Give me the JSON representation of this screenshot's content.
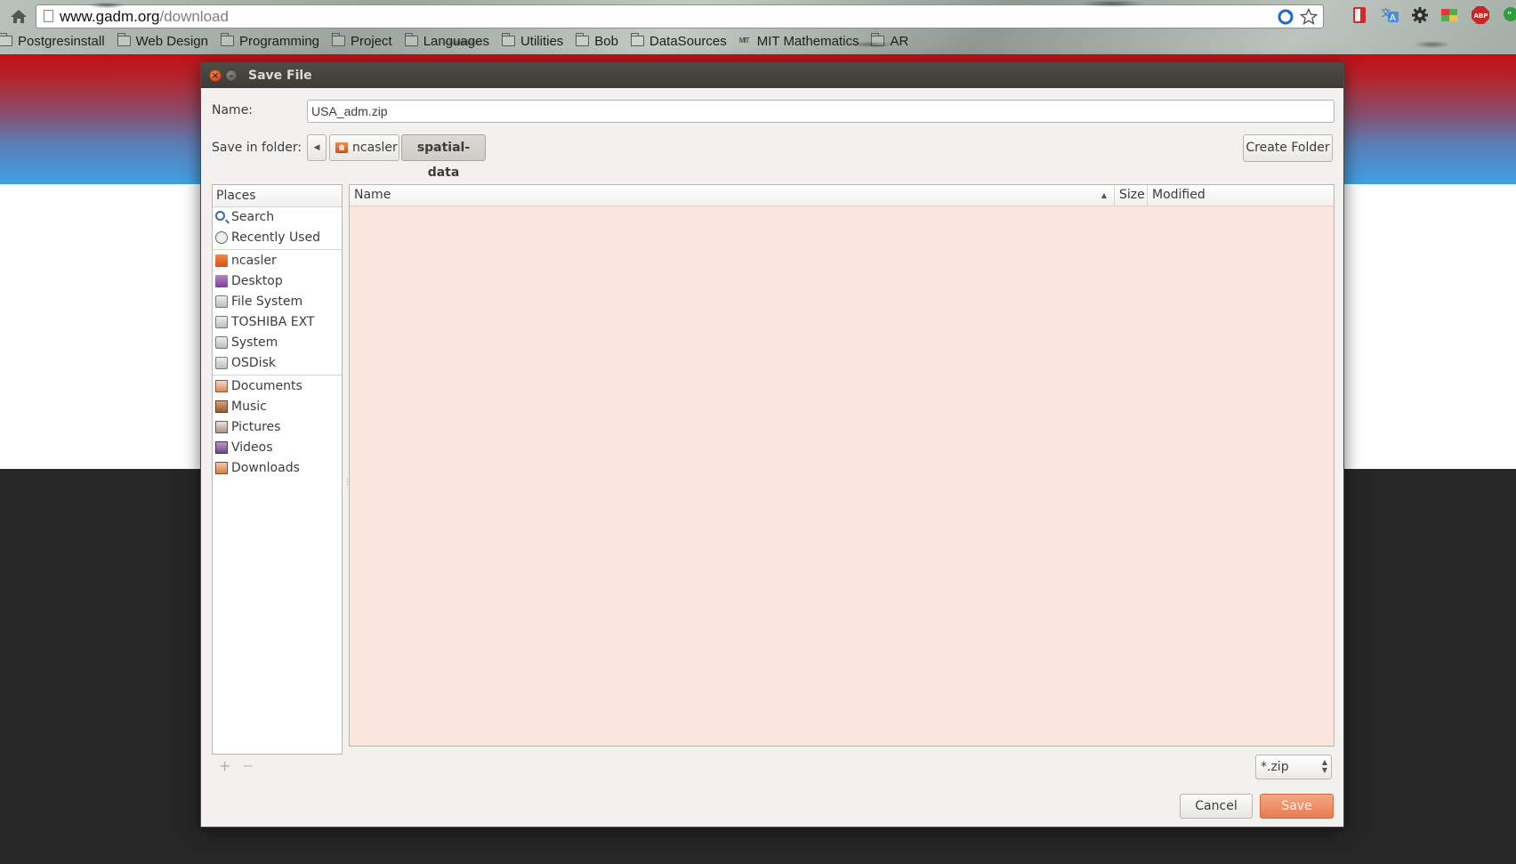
{
  "browser": {
    "url_domain": "www.gadm.org",
    "url_path": "/download",
    "bookmarks": [
      {
        "label": "Postgresinstall",
        "icon": "folder-icon"
      },
      {
        "label": "Web Design",
        "icon": "folder-icon"
      },
      {
        "label": "Programming",
        "icon": "folder-icon"
      },
      {
        "label": "Project",
        "icon": "folder-icon"
      },
      {
        "label": "Languages",
        "icon": "folder-icon"
      },
      {
        "label": "Utilities",
        "icon": "folder-icon"
      },
      {
        "label": "Bob",
        "icon": "folder-icon"
      },
      {
        "label": "DataSources",
        "icon": "folder-icon"
      },
      {
        "label": "MIT Mathematics",
        "icon": "mit-icon"
      },
      {
        "label": "AR",
        "icon": "folder-icon"
      }
    ]
  },
  "dialog": {
    "title": "Save File",
    "name_label": "Name:",
    "name_value": "USA_adm.zip",
    "save_in_label": "Save in folder:",
    "path": [
      "ncasler",
      "spatial-data"
    ],
    "create_folder": "Create Folder",
    "places_header": "Places",
    "places": [
      {
        "label": "Search",
        "icon": "search-icon"
      },
      {
        "label": "Recently Used",
        "icon": "clock-icon"
      },
      {
        "label": "ncasler",
        "icon": "home-folder-icon"
      },
      {
        "label": "Desktop",
        "icon": "desktop-icon"
      },
      {
        "label": "File System",
        "icon": "drive-icon"
      },
      {
        "label": "TOSHIBA EXT",
        "icon": "drive-icon"
      },
      {
        "label": "System",
        "icon": "drive-icon"
      },
      {
        "label": "OSDisk",
        "icon": "drive-icon"
      },
      {
        "label": "Documents",
        "icon": "documents-icon"
      },
      {
        "label": "Music",
        "icon": "music-icon"
      },
      {
        "label": "Pictures",
        "icon": "pictures-icon"
      },
      {
        "label": "Videos",
        "icon": "videos-icon"
      },
      {
        "label": "Downloads",
        "icon": "downloads-icon"
      }
    ],
    "columns": {
      "name": "Name",
      "size": "Size",
      "modified": "Modified"
    },
    "add_symbol": "+",
    "remove_symbol": "−",
    "filter_value": "*.zip",
    "cancel": "Cancel",
    "save": "Save"
  },
  "colors": {
    "accent": "#e77c51",
    "file_list_bg": "#fbe6de",
    "titlebar": "#3c3b37"
  }
}
